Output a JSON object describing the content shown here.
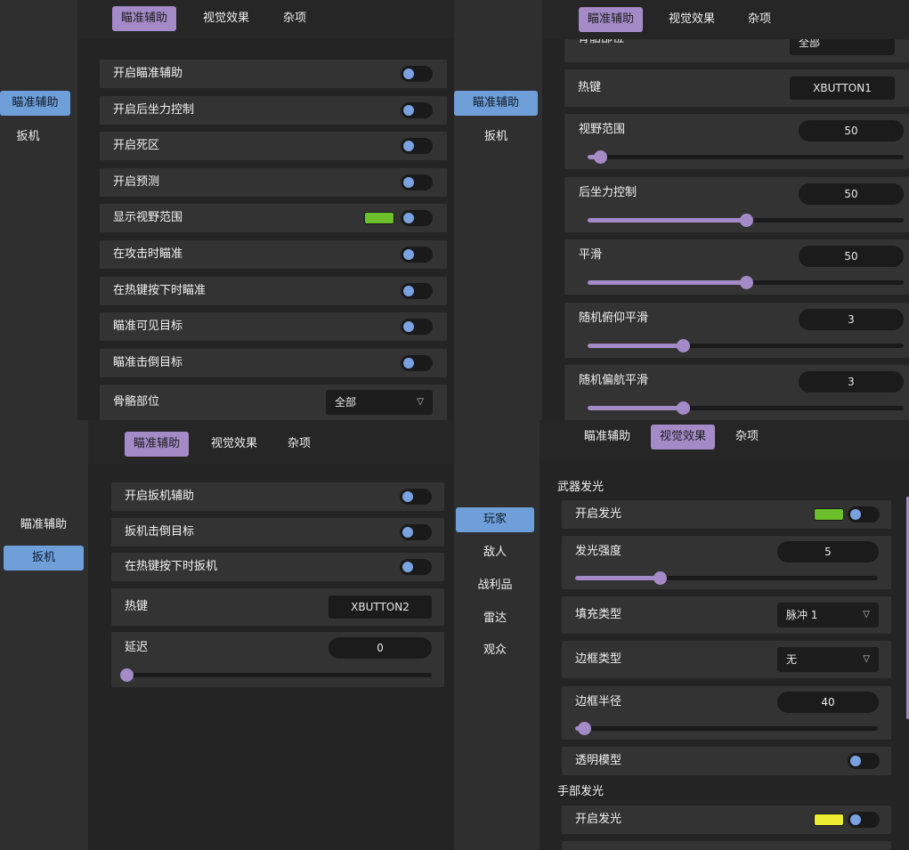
{
  "colors": {
    "accent": "#a48bc8",
    "sidebar_active": "#6f9fd9",
    "toggle_knob": "#7aa2e0",
    "swatch_green": "#6cc02b",
    "swatch_yellow": "#ecec32"
  },
  "tabs": {
    "aim": "瞄准辅助",
    "visual": "视觉效果",
    "misc": "杂项"
  },
  "panel1": {
    "sidebar": {
      "aim": "瞄准辅助",
      "trigger": "扳机"
    },
    "rows": [
      {
        "label": "开启瞄准辅助",
        "enabled": false
      },
      {
        "label": "开启后坐力控制",
        "enabled": false
      },
      {
        "label": "开启死区",
        "enabled": false
      },
      {
        "label": "开启预测",
        "enabled": false
      },
      {
        "label": "显示视野范围",
        "enabled": false,
        "swatch_color": "#6cc02b"
      },
      {
        "label": "在攻击时瞄准",
        "enabled": false
      },
      {
        "label": "在热键按下时瞄准",
        "enabled": false
      },
      {
        "label": "瞄准可见目标",
        "enabled": false
      },
      {
        "label": "瞄准击倒目标",
        "enabled": false
      }
    ],
    "bone": {
      "label": "骨骼部位",
      "value": "全部",
      "caret": "▽"
    }
  },
  "panel2": {
    "sidebar": {
      "aim": "瞄准辅助",
      "trigger": "扳机"
    },
    "bone_partial": {
      "label": "骨骼部位",
      "value": "全部"
    },
    "hotkey": {
      "label": "热键",
      "value": "XBUTTON1"
    },
    "sliders": [
      {
        "label": "视野范围",
        "value": "50",
        "fill": 0.04
      },
      {
        "label": "后坐力控制",
        "value": "50",
        "fill": 0.5
      },
      {
        "label": "平滑",
        "value": "50",
        "fill": 0.5
      },
      {
        "label": "随机俯仰平滑",
        "value": "3",
        "fill": 0.3
      },
      {
        "label": "随机偏航平滑",
        "value": "3",
        "fill": 0.3
      }
    ]
  },
  "panel3": {
    "sidebar": {
      "aim": "瞄准辅助",
      "trigger": "扳机"
    },
    "rows": [
      {
        "label": "开启扳机辅助",
        "enabled": false
      },
      {
        "label": "扳机击倒目标",
        "enabled": false
      },
      {
        "label": "在热键按下时扳机",
        "enabled": false
      }
    ],
    "hotkey": {
      "label": "热键",
      "value": "XBUTTON2"
    },
    "delay": {
      "label": "延迟",
      "value": "0",
      "fill": 0.0
    }
  },
  "panel4": {
    "sidebar": {
      "player": "玩家",
      "enemy": "敌人",
      "loot": "战利品",
      "radar": "雷达",
      "spectator": "观众"
    },
    "weapon_glow": {
      "title": "武器发光",
      "enable": {
        "label": "开启发光",
        "enabled": false,
        "swatch_color": "#6cc02b"
      },
      "intensity": {
        "label": "发光强度",
        "value": "5",
        "fill": 0.28
      },
      "fill_type": {
        "label": "填充类型",
        "value": "脉冲 1",
        "caret": "▽"
      },
      "border_type": {
        "label": "边框类型",
        "value": "无",
        "caret": "▽"
      },
      "border_radius": {
        "label": "边框半径",
        "value": "40",
        "fill": 0.03
      },
      "transparent": {
        "label": "透明模型",
        "enabled": false
      }
    },
    "hand_glow": {
      "title": "手部发光",
      "enable": {
        "label": "开启发光",
        "enabled": false,
        "swatch_color": "#ecec32"
      }
    }
  }
}
